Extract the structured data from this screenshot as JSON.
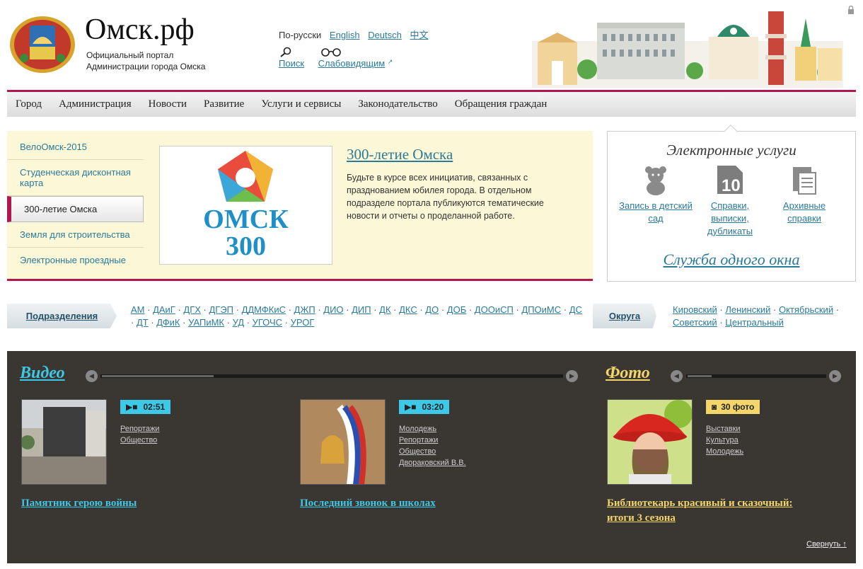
{
  "header": {
    "title": "Омск.рф",
    "subtitle_line1": "Официальный портал",
    "subtitle_line2": "Администрации города Омска",
    "languages": [
      "По-русски",
      "English",
      "Deutsch",
      "中文"
    ],
    "search_label": "Поиск",
    "low_vision_label": "Слабовидящим"
  },
  "nav": [
    "Город",
    "Администрация",
    "Новости",
    "Развитие",
    "Услуги и сервисы",
    "Законодательство",
    "Обращения граждан"
  ],
  "feature": {
    "side_items": [
      "ВелоОмск-2015",
      "Студенческая дисконтная карта",
      "300-летие Омска",
      "Земля для строительства",
      "Электронные проездные"
    ],
    "image_text": "ОМСК 300",
    "title": "300-летие Омска",
    "text": "Будьте в курсе всех инициатив, связанных с празднованием юбилея города. В отдельном подразделе портала публикуются тематические новости и отчеты о проделанной работе."
  },
  "eservices": {
    "title": "Электронные услуги",
    "items": [
      {
        "label": "Запись в детский сад",
        "icon": "teddy-bear-icon"
      },
      {
        "label": "Справки, выписки, дубликаты",
        "icon": "document-10-icon"
      },
      {
        "label": "Архивные справки",
        "icon": "archive-icon"
      }
    ],
    "one_window": "Служба одного окна"
  },
  "departments": {
    "button": "Подразделения",
    "links": [
      "АМ",
      "ДАиГ",
      "ДГХ",
      "ДГЭП",
      "ДДМФКиС",
      "ДЖП",
      "ДИО",
      "ДИП",
      "ДК",
      "ДКС",
      "ДО",
      "ДОБ",
      "ДООиСП",
      "ДПОиМС",
      "ДС",
      "ДТ",
      "ДФиК",
      "УАПиМК",
      "УД",
      "УГОЧС",
      "УРОГ"
    ]
  },
  "districts": {
    "button": "Округа",
    "links": [
      "Кировский",
      "Ленинский",
      "Октябрьский",
      "Советский",
      "Центральный"
    ]
  },
  "media": {
    "video_title": "Видео",
    "photo_title": "Фото",
    "videos": [
      {
        "duration": "02:51",
        "tags": [
          "Репортажи",
          "Общество"
        ],
        "caption": "Памятник герою войны"
      },
      {
        "duration": "03:20",
        "tags": [
          "Молодежь",
          "Репортажи",
          "Общество",
          "Дворақовский В.В."
        ],
        "caption": "Последний звонок в школах"
      }
    ],
    "photo": {
      "count": "30 фото",
      "tags": [
        "Выставки",
        "Культура",
        "Молодежь"
      ],
      "caption": "Библиотекарь красивый и сказочный: итоги 3 сезона"
    },
    "collapse": "Свернуть ↑",
    "colors": {
      "video": "#3cc8e6",
      "photo": "#f3d56a",
      "bg": "#3a3733"
    }
  }
}
